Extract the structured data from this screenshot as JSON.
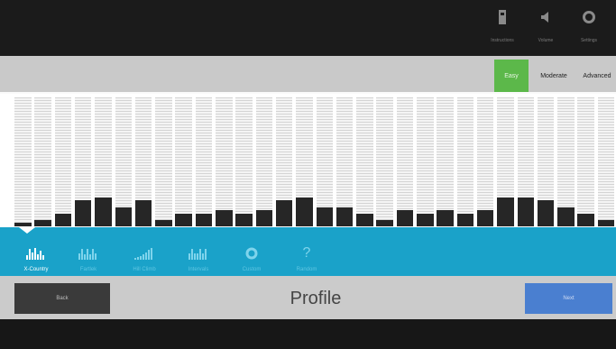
{
  "top_icons": [
    {
      "name": "instructions-icon",
      "label": "Instructions"
    },
    {
      "name": "volume-icon",
      "label": "Volume"
    },
    {
      "name": "settings-icon",
      "label": "Settings"
    }
  ],
  "levels": [
    {
      "label": "Easy",
      "active": true
    },
    {
      "label": "Moderate",
      "active": false
    },
    {
      "label": "Advanced",
      "active": false
    }
  ],
  "chart_data": {
    "type": "bar",
    "ylim": [
      0,
      40
    ],
    "values": [
      1,
      2,
      4,
      8,
      9,
      6,
      8,
      2,
      4,
      4,
      5,
      4,
      5,
      8,
      9,
      6,
      6,
      4,
      2,
      5,
      4,
      5,
      4,
      5,
      9,
      9,
      8,
      6,
      4,
      2
    ]
  },
  "tabs": [
    {
      "label": "X-Country",
      "icon": "x-country-icon",
      "active": true
    },
    {
      "label": "Fartlek",
      "icon": "fartlek-icon",
      "active": false
    },
    {
      "label": "Hill Climb",
      "icon": "hill-climb-icon",
      "active": false
    },
    {
      "label": "Intervals",
      "icon": "intervals-icon",
      "active": false
    },
    {
      "label": "Custom",
      "icon": "custom-icon",
      "active": false
    },
    {
      "label": "Random",
      "icon": "random-icon",
      "active": false
    }
  ],
  "bottom": {
    "back_label": "Back",
    "title": "Profile",
    "next_label": "Next"
  },
  "colors": {
    "accent_green": "#5cb84a",
    "tab_blue": "#1aa2c9",
    "next_blue": "#4a7fd0"
  }
}
